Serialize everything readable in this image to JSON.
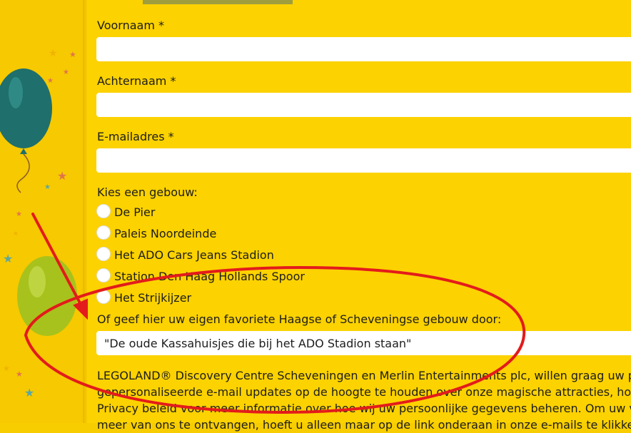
{
  "form": {
    "first_name_label": "Voornaam *",
    "last_name_label": "Achternaam *",
    "email_label": "E-mailadres *",
    "building_question": "Kies een gebouw:",
    "options": [
      "De Pier",
      "Paleis Noordeinde",
      "Het ADO Cars Jeans Stadion",
      "Station Den Haag Hollands Spoor",
      "Het Strijkijzer"
    ],
    "own_building_label": "Of geef hier uw eigen favoriete Haagse of Scheveningse gebouw door:",
    "own_building_value": "\"De oude Kassahuisjes die bij het ADO Stadion staan\""
  },
  "disclaimer": {
    "lines": [
      "LEGOLAND® Discovery Centre Scheveningen en Merlin Entertainments plc, willen graag uw per",
      "gepersonaliseerde e-mail updates op de hoogte te houden over onze magische attracties, hote",
      "Privacy beleid voor meer informatie over hoe wij uw persoonlijke gegevens beheren. Om uw vo",
      "meer van ons te ontvangen, hoeft u alleen maar op de link onderaan in onze e-mails te klikken"
    ]
  },
  "annotation": {
    "color": "#e31b1b"
  },
  "colors": {
    "background": "#fcd200",
    "input": "#ffffff"
  }
}
